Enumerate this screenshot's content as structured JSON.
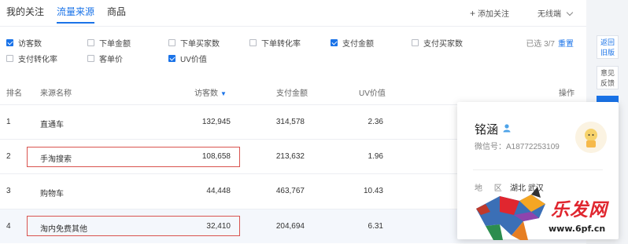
{
  "tabs": [
    {
      "label": "我的关注"
    },
    {
      "label": "流量来源"
    },
    {
      "label": "商品"
    }
  ],
  "header": {
    "add_follow": "添加关注",
    "device": "无线端"
  },
  "metrics": [
    {
      "label": "访客数",
      "checked": true
    },
    {
      "label": "下单金额",
      "checked": false
    },
    {
      "label": "下单买家数",
      "checked": false
    },
    {
      "label": "下单转化率",
      "checked": false
    },
    {
      "label": "支付金额",
      "checked": true
    },
    {
      "label": "支付买家数",
      "checked": false
    },
    {
      "label": "支付转化率",
      "checked": false
    },
    {
      "label": "客单价",
      "checked": false
    },
    {
      "label": "UV价值",
      "checked": true
    }
  ],
  "selection": {
    "text": "已选 3/7",
    "reset": "重置"
  },
  "table": {
    "headers": [
      "排名",
      "来源名称",
      "访客数",
      "支付金额",
      "UV价值",
      "操作"
    ],
    "rows": [
      {
        "rank": "1",
        "source": "直通车",
        "visitors": "132,945",
        "amount": "314,578",
        "uv": "2.36"
      },
      {
        "rank": "2",
        "source": "手淘搜索",
        "visitors": "108,658",
        "amount": "213,632",
        "uv": "1.96"
      },
      {
        "rank": "3",
        "source": "购物车",
        "visitors": "44,448",
        "amount": "463,767",
        "uv": "10.43"
      },
      {
        "rank": "4",
        "source": "淘内免费其他",
        "visitors": "32,410",
        "amount": "204,694",
        "uv": "6.31"
      }
    ]
  },
  "card": {
    "name": "铭涵",
    "wechat": "微信号：A18772253109",
    "region_label": "地 区",
    "region_value": "湖北 武汉"
  },
  "sidebar": {
    "back_old": "返回旧版",
    "feedback": "意见反馈"
  },
  "watermark": {
    "text": "乐发网",
    "url": "www.6pf.cn"
  },
  "colors": {
    "accent": "#1a73e8",
    "highlight_border": "#d9534f"
  }
}
